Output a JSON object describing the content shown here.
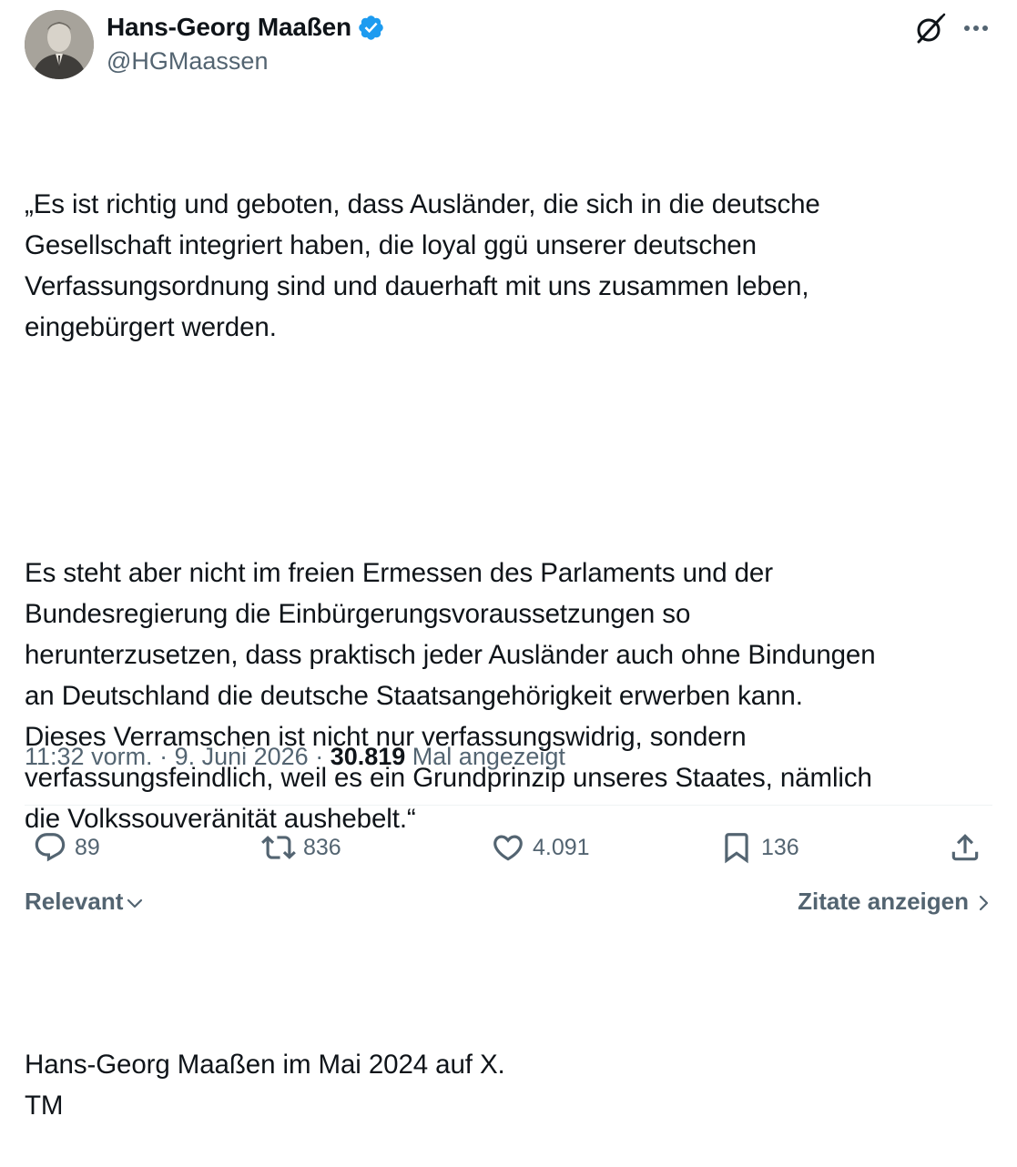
{
  "author": {
    "display_name": "Hans-Georg Maaßen",
    "handle": "@HGMaassen",
    "verified": true,
    "verified_color": "#1d9bf0"
  },
  "tweet": {
    "paragraphs": [
      "„Es ist richtig und geboten, dass Ausländer, die sich in die deutsche\nGesellschaft integriert haben, die loyal ggü unserer deutschen\nVerfassungsordnung sind und dauerhaft mit uns zusammen leben,\neingebürgert werden.",
      "Es steht aber nicht im freien Ermessen des Parlaments und der\nBundesregierung die Einbürgerungsvoraussetzungen so\nherunterzusetzen, dass praktisch jeder Ausländer auch ohne Bindungen\nan Deutschland die deutsche Staatsangehörigkeit erwerben kann.\nDieses Verramschen ist nicht nur verfassungswidrig, sondern\nverfassungsfeindlich, weil es ein Grundprinzip unseres Staates, nämlich\ndie Volkssouveränität aushebelt.“",
      "Hans-Georg Maaßen im Mai 2024 auf X.\nTM"
    ]
  },
  "meta": {
    "time": "11:32 vorm.",
    "separator": " · ",
    "date": "9. Juni 2026",
    "views_count": "30.819",
    "views_label": " Mal angezeigt"
  },
  "actions": {
    "replies": "89",
    "reposts": "836",
    "likes": "4.091",
    "bookmarks": "136"
  },
  "footer": {
    "sort_label": "Relevant",
    "quotes_label": "Zitate anzeigen"
  },
  "icons": {
    "verified": "verified-badge-icon",
    "grok": "grok-icon",
    "more": "more-icon",
    "reply": "reply-icon",
    "repost": "repost-icon",
    "like": "heart-icon",
    "bookmark": "bookmark-icon",
    "share": "share-icon",
    "chevron_down": "chevron-down-icon",
    "chevron_right": "chevron-right-icon"
  },
  "colors": {
    "text_primary": "#0f1419",
    "text_secondary": "#536471",
    "divider": "#eff3f4"
  }
}
